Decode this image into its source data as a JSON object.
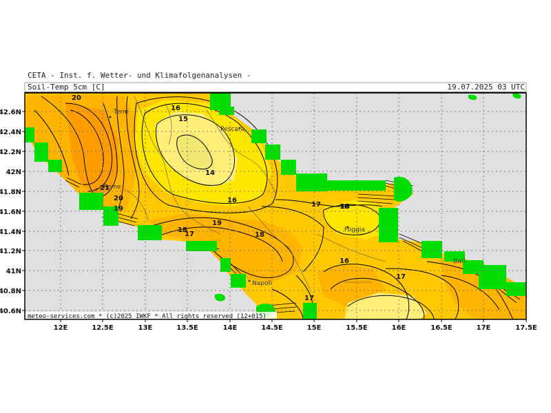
{
  "header": {
    "institute": "CETA - Inst. f. Wetter- und Klimafolgenanalysen -",
    "field": "Soil-Temp 5cm [C]",
    "valid_time": "19.07.2025 03 UTC"
  },
  "footer": {
    "credit": "meteo-services.com * (c)2025 IWKF * All rights reserved (12+015)"
  },
  "axes": {
    "lon_labels": [
      "12E",
      "12.5E",
      "13E",
      "13.5E",
      "14E",
      "14.5E",
      "15E",
      "15.5E",
      "16E",
      "16.5E",
      "17E",
      "17.5E"
    ],
    "lat_labels": [
      "42.6N",
      "42.4N",
      "42.2N",
      "42N",
      "41.8N",
      "41.6N",
      "41.4N",
      "41.2N",
      "41N",
      "40.8N",
      "40.6N"
    ]
  },
  "cities": [
    "Terni",
    "Pescara",
    "Rome",
    "Foggia",
    "Napoli",
    "Bari"
  ],
  "contour_labels": [
    "20",
    "15",
    "16",
    "14",
    "21",
    "20",
    "19",
    "16",
    "17",
    "18",
    "18",
    "17",
    "19",
    "18",
    "18",
    "16",
    "17",
    "17"
  ],
  "colors": {
    "sea": "#e0e0e0",
    "land_coast_cells": "#00dd00",
    "t14_15": "#ffef78",
    "t16": "#ffe600",
    "t17_18": "#ffc800",
    "t19_20": "#ffb400",
    "t21": "#ff9c00"
  }
}
